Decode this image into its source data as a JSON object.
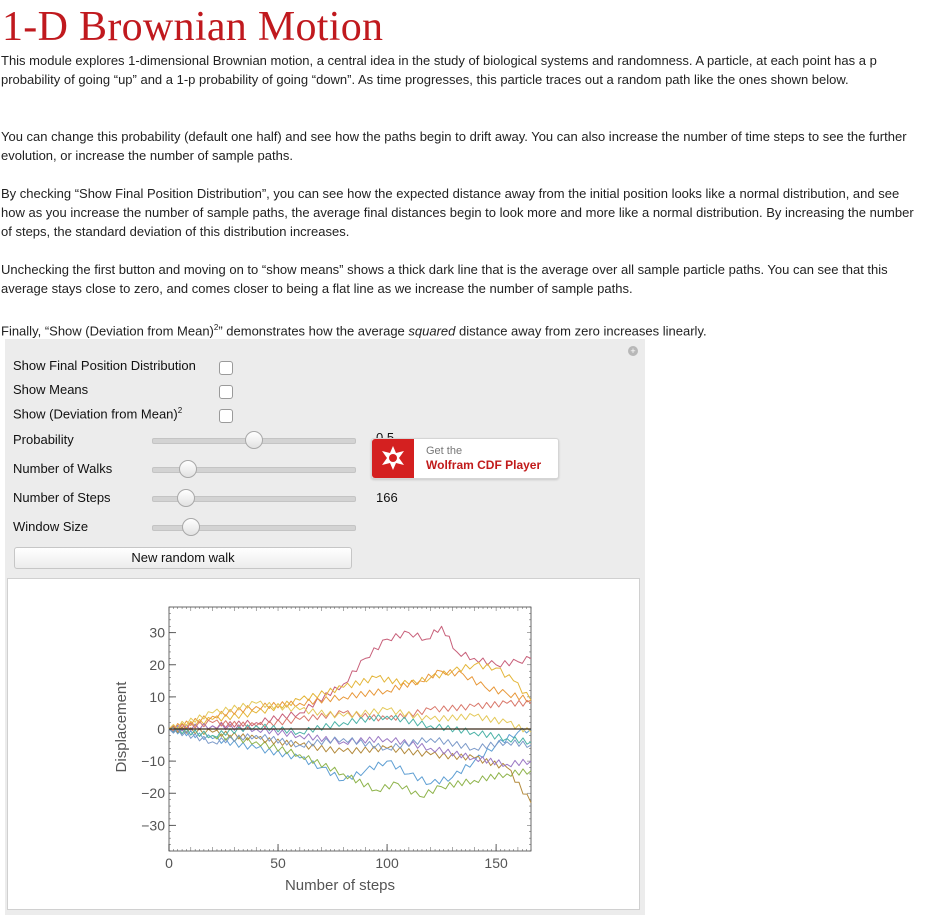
{
  "page": {
    "title": "1-D Brownian Motion",
    "p1": "This module explores 1-dimensional Brownian motion, a central idea in the study of biological systems and randomness. A particle, at each point has a p probability of going “up” and a 1-p probability of going “down”. As time progresses, this particle traces out a random path like the ones shown below.",
    "p2": "You can change this probability (default one half) and see how the paths begin to drift away. You can also increase the number of time steps to see the further evolution, or increase the number of sample paths.",
    "p3": "By checking “Show Final Position Distribution”, you can see how the expected distance away from the initial position looks like a normal distribution, and see how as you increase the number of sample paths, the average final distances begin to look more and more like a normal distribution. By increasing the number of steps, the standard deviation of this distribution increases.",
    "p4": "Unchecking the first button and moving on to “show means” shows a thick dark line that is the average over all sample particle paths. You can see that this average stays close to zero, and comes closer to being a flat line as we increase the number of sample paths.",
    "p5_before": "Finally, “Show (Deviation from Mean)",
    "p5_sup": "2",
    "p5_mid": "” demonstrates how the average ",
    "p5_em": "squared",
    "p5_after": " distance away from zero increases linearly."
  },
  "controls": {
    "reset_glyph": "+",
    "show_final_label": "Show Final Position Distribution",
    "show_means_label": "Show Means",
    "show_dev_label": "Show (Deviation from Mean)",
    "show_dev_sup": "2",
    "probability_label": "Probability",
    "probability_value": "0.5",
    "probability_level": 0.5,
    "walks_label": "Number of Walks",
    "walks_level": 0.14,
    "steps_label": "Number of Steps",
    "steps_value": "166",
    "steps_level": 0.13,
    "window_label": "Window Size",
    "window_level": 0.16,
    "new_walk_label": "New random walk"
  },
  "cdf_badge": {
    "get_text": "Get the",
    "name": "Wolfram CDF Player",
    "logo_icon": "wolfram-spikey-icon",
    "color": "#d42020"
  },
  "chart_data": {
    "type": "line",
    "title": "",
    "xlabel": "Number of steps",
    "ylabel": "Displacement",
    "xlim": [
      0,
      166
    ],
    "ylim": [
      -38,
      38
    ],
    "xticks": [
      0,
      50,
      100,
      150
    ],
    "yticks": [
      30,
      20,
      10,
      0,
      -10,
      -20,
      -30
    ],
    "xtick_labels": [
      "0",
      "50",
      "100",
      "150"
    ],
    "ytick_labels": [
      "30",
      "20",
      "10",
      "0",
      "−10",
      "−20",
      "−30"
    ],
    "grid": false,
    "frame": true,
    "zero_line": true,
    "series": [
      {
        "color": "#c8607a",
        "points": [
          [
            0,
            0
          ],
          [
            20,
            1
          ],
          [
            40,
            2
          ],
          [
            60,
            5
          ],
          [
            80,
            14
          ],
          [
            90,
            22
          ],
          [
            100,
            28
          ],
          [
            110,
            30
          ],
          [
            118,
            28
          ],
          [
            125,
            32
          ],
          [
            132,
            24
          ],
          [
            140,
            22
          ],
          [
            150,
            20
          ],
          [
            160,
            21
          ],
          [
            166,
            22
          ]
        ]
      },
      {
        "color": "#e4b63a",
        "points": [
          [
            0,
            0
          ],
          [
            20,
            3
          ],
          [
            40,
            5
          ],
          [
            60,
            9
          ],
          [
            80,
            13
          ],
          [
            95,
            16
          ],
          [
            110,
            14
          ],
          [
            120,
            16
          ],
          [
            130,
            18
          ],
          [
            140,
            20
          ],
          [
            150,
            19
          ],
          [
            158,
            15
          ],
          [
            166,
            9
          ]
        ]
      },
      {
        "color": "#e8983a",
        "points": [
          [
            0,
            0
          ],
          [
            20,
            4
          ],
          [
            40,
            7
          ],
          [
            60,
            8
          ],
          [
            80,
            10
          ],
          [
            100,
            12
          ],
          [
            115,
            15
          ],
          [
            125,
            18
          ],
          [
            135,
            17
          ],
          [
            145,
            13
          ],
          [
            155,
            11
          ],
          [
            166,
            9
          ]
        ]
      },
      {
        "color": "#5f9fd3",
        "points": [
          [
            0,
            0
          ],
          [
            20,
            -3
          ],
          [
            40,
            -6
          ],
          [
            60,
            -9
          ],
          [
            70,
            -12
          ],
          [
            80,
            -16
          ],
          [
            90,
            -13
          ],
          [
            100,
            -10
          ],
          [
            110,
            -14
          ],
          [
            120,
            -17
          ],
          [
            130,
            -15
          ],
          [
            140,
            -10
          ],
          [
            150,
            -5
          ],
          [
            160,
            -1
          ],
          [
            166,
            0
          ]
        ]
      },
      {
        "color": "#8fb44c",
        "points": [
          [
            0,
            0
          ],
          [
            20,
            -2
          ],
          [
            40,
            -4
          ],
          [
            60,
            -8
          ],
          [
            80,
            -14
          ],
          [
            95,
            -19
          ],
          [
            105,
            -17
          ],
          [
            115,
            -21
          ],
          [
            125,
            -18
          ],
          [
            140,
            -16
          ],
          [
            155,
            -14
          ],
          [
            166,
            -13
          ]
        ]
      },
      {
        "color": "#b38a3c",
        "points": [
          [
            0,
            0
          ],
          [
            20,
            -1
          ],
          [
            40,
            -3
          ],
          [
            60,
            -5
          ],
          [
            80,
            -7
          ],
          [
            100,
            -6
          ],
          [
            120,
            -8
          ],
          [
            140,
            -9
          ],
          [
            155,
            -12
          ],
          [
            166,
            -23
          ]
        ]
      },
      {
        "color": "#9a78c4",
        "points": [
          [
            0,
            0
          ],
          [
            20,
            1
          ],
          [
            40,
            0
          ],
          [
            60,
            -2
          ],
          [
            80,
            -4
          ],
          [
            100,
            -3
          ],
          [
            120,
            -6
          ],
          [
            140,
            -9
          ],
          [
            155,
            -11
          ],
          [
            166,
            -10
          ]
        ]
      },
      {
        "color": "#d9776a",
        "points": [
          [
            0,
            0
          ],
          [
            20,
            2
          ],
          [
            40,
            1
          ],
          [
            60,
            3
          ],
          [
            80,
            5
          ],
          [
            100,
            3
          ],
          [
            120,
            6
          ],
          [
            140,
            7
          ],
          [
            155,
            8
          ],
          [
            166,
            8
          ]
        ]
      },
      {
        "color": "#4db3a8",
        "points": [
          [
            0,
            0
          ],
          [
            20,
            -2
          ],
          [
            40,
            1
          ],
          [
            60,
            -1
          ],
          [
            80,
            2
          ],
          [
            100,
            4
          ],
          [
            120,
            1
          ],
          [
            140,
            -1
          ],
          [
            155,
            -3
          ],
          [
            166,
            -4
          ]
        ]
      },
      {
        "color": "#e4c95a",
        "points": [
          [
            0,
            0
          ],
          [
            20,
            5
          ],
          [
            40,
            8
          ],
          [
            60,
            6
          ],
          [
            80,
            4
          ],
          [
            100,
            6
          ],
          [
            120,
            3
          ],
          [
            140,
            4
          ],
          [
            155,
            2
          ],
          [
            166,
            -1
          ]
        ]
      },
      {
        "color": "#7c9ac9",
        "points": [
          [
            0,
            0
          ],
          [
            20,
            -4
          ],
          [
            40,
            -2
          ],
          [
            60,
            -5
          ],
          [
            80,
            -3
          ],
          [
            100,
            -6
          ],
          [
            120,
            -3
          ],
          [
            140,
            -6
          ],
          [
            155,
            -4
          ],
          [
            166,
            -5
          ]
        ]
      }
    ]
  }
}
